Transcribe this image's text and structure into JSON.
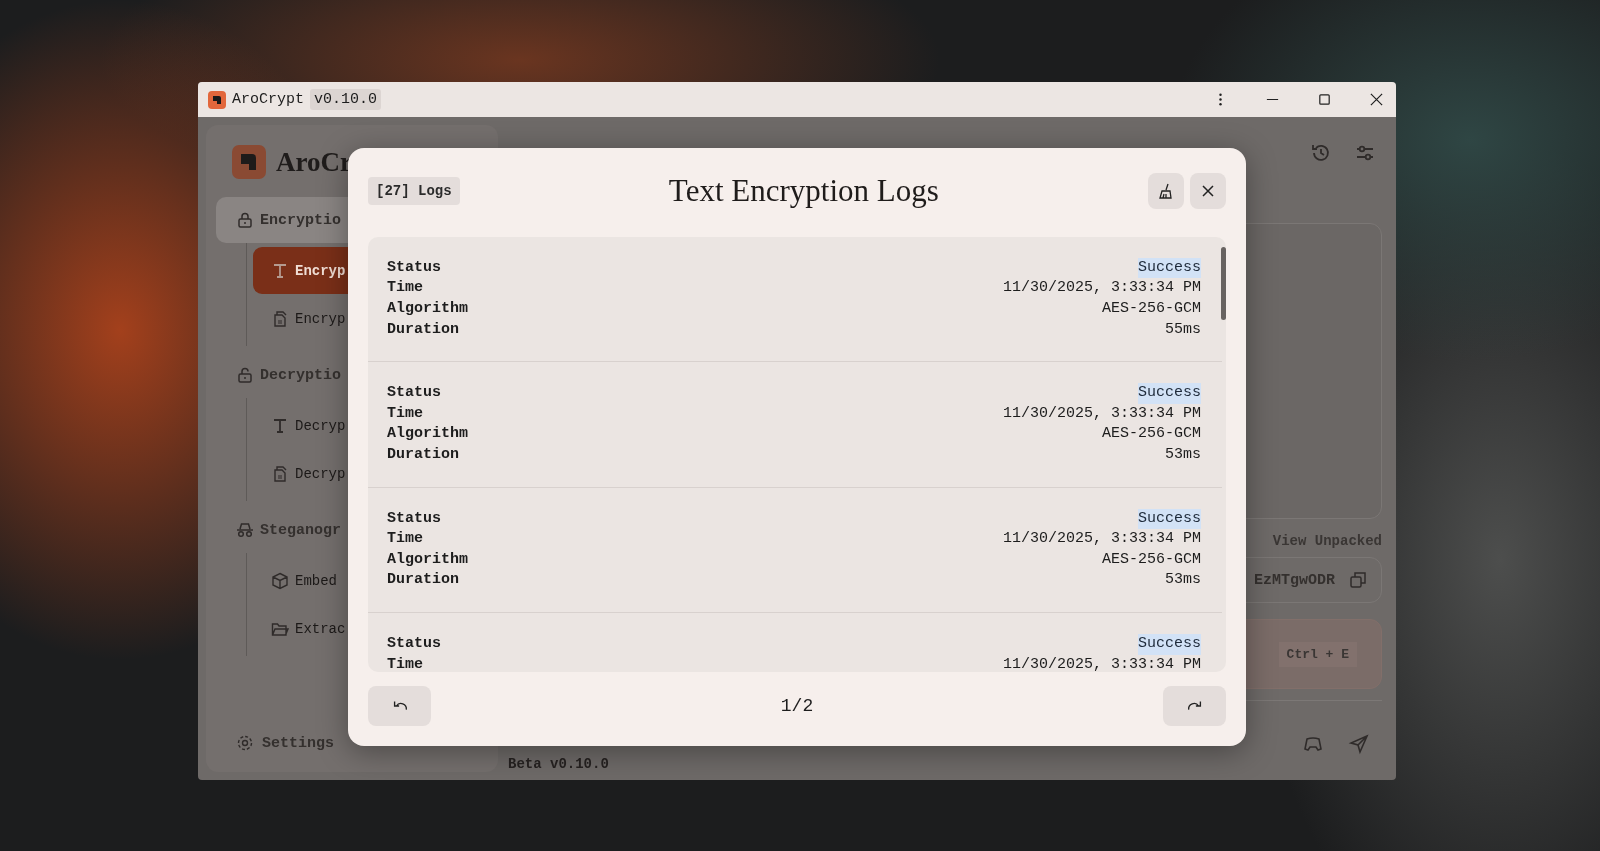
{
  "window": {
    "app_name": "AroCrypt",
    "version": "v0.10.0"
  },
  "sidebar": {
    "brand": "AroCr",
    "groups": [
      {
        "label": "Encryptio",
        "selected": true,
        "items": [
          {
            "label": "Encryp",
            "kind": "text",
            "selected": true
          },
          {
            "label": "Encryp",
            "kind": "file",
            "selected": false
          }
        ]
      },
      {
        "label": "Decryptio",
        "selected": false,
        "items": [
          {
            "label": "Decryp",
            "kind": "text",
            "selected": false
          },
          {
            "label": "Decryp",
            "kind": "file",
            "selected": false
          }
        ]
      },
      {
        "label": "Steganogr",
        "selected": false,
        "items": [
          {
            "label": "Embed",
            "kind": "box",
            "selected": false
          },
          {
            "label": "Extrac",
            "kind": "folder",
            "selected": false
          }
        ]
      }
    ],
    "settings": "Settings"
  },
  "main": {
    "view_unpacked": "View Unpacked",
    "output_value": "EzMTgwODR",
    "shortcut": "Ctrl + E",
    "footer_version": "Beta v0.10.0"
  },
  "modal": {
    "count_badge": "[27] Logs",
    "title": "Text Encryption Logs",
    "page": "1/2",
    "entries": [
      {
        "fields": [
          {
            "label": "Status",
            "value": "Success",
            "kind": "status"
          },
          {
            "label": "Time",
            "value": "11/30/2025, 3:33:34 PM",
            "kind": "plain"
          },
          {
            "label": "Algorithm",
            "value": "AES-256-GCM",
            "kind": "plain"
          },
          {
            "label": "Duration",
            "value": "55ms",
            "kind": "plain"
          }
        ]
      },
      {
        "fields": [
          {
            "label": "Status",
            "value": "Success",
            "kind": "status"
          },
          {
            "label": "Time",
            "value": "11/30/2025, 3:33:34 PM",
            "kind": "plain"
          },
          {
            "label": "Algorithm",
            "value": "AES-256-GCM",
            "kind": "plain"
          },
          {
            "label": "Duration",
            "value": "53ms",
            "kind": "plain"
          }
        ]
      },
      {
        "fields": [
          {
            "label": "Status",
            "value": "Success",
            "kind": "status"
          },
          {
            "label": "Time",
            "value": "11/30/2025, 3:33:34 PM",
            "kind": "plain"
          },
          {
            "label": "Algorithm",
            "value": "AES-256-GCM",
            "kind": "plain"
          },
          {
            "label": "Duration",
            "value": "53ms",
            "kind": "plain"
          }
        ]
      },
      {
        "fields": [
          {
            "label": "Status",
            "value": "Success",
            "kind": "status"
          },
          {
            "label": "Time",
            "value": "11/30/2025, 3:33:34 PM",
            "kind": "plain"
          }
        ]
      }
    ]
  }
}
